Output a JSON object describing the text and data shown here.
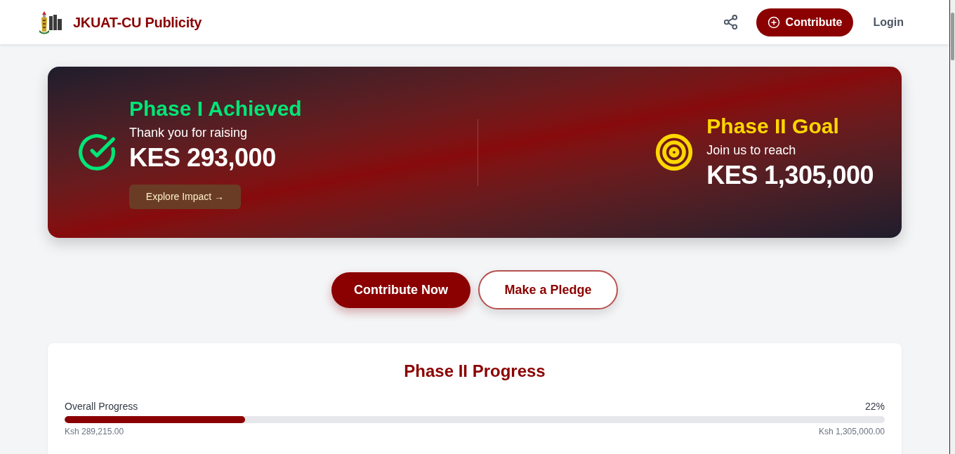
{
  "header": {
    "brand": "JKUAT-CU Publicity",
    "contribute_button": "Contribute",
    "login_link": "Login"
  },
  "hero": {
    "achieved": {
      "title": "Phase I Achieved",
      "subtitle": "Thank you for raising",
      "amount": "KES 293,000",
      "button": "Explore Impact →"
    },
    "goal": {
      "title": "Phase II Goal",
      "subtitle": "Join us to reach",
      "amount": "KES 1,305,000"
    }
  },
  "actions": [
    {
      "label": "Contribute Now",
      "kind": "primary"
    },
    {
      "label": "Make a Pledge",
      "kind": "outline"
    }
  ],
  "progress": {
    "title": "Phase II Progress",
    "label": "Overall Progress",
    "percent": "22%",
    "level": 0.22,
    "raised": "Ksh 289,215.00",
    "target": "Ksh 1,305,000.00"
  }
}
